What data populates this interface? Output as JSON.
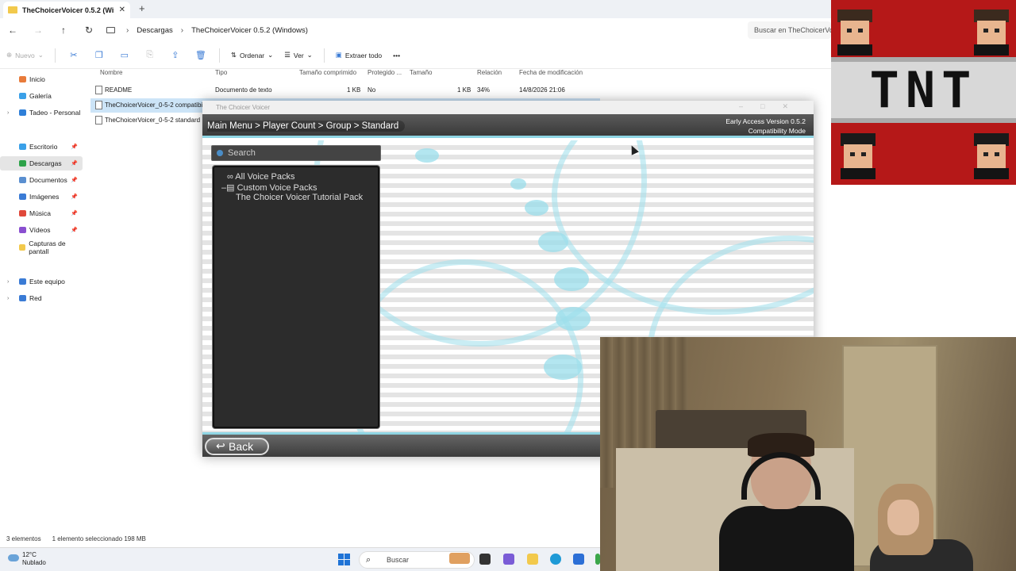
{
  "explorer": {
    "tab_title": "TheChoicerVoicer 0.5.2 (Wind",
    "tab_close": "✕",
    "new_tab": "+",
    "path": [
      "Descargas",
      "TheChoicerVoicer 0.5.2 (Windows)"
    ],
    "search_placeholder": "Buscar en TheChoicerVo",
    "toolbar": {
      "new": "Nuevo",
      "sort": "Ordenar",
      "view": "Ver",
      "extract": "Extraer todo",
      "more": "•••"
    },
    "sidebar": {
      "items": [
        {
          "label": "Inicio",
          "color": "#e87b3a"
        },
        {
          "label": "Galería",
          "color": "#3aa0e8"
        },
        {
          "label": "Tadeo - Personal",
          "color": "#2f7fd8"
        },
        {
          "label": "Escritorio",
          "color": "#3aa0e8"
        },
        {
          "label": "Descargas",
          "color": "#2ea34a"
        },
        {
          "label": "Documentos",
          "color": "#5a8fd0"
        },
        {
          "label": "Imágenes",
          "color": "#3a7bd5"
        },
        {
          "label": "Música",
          "color": "#e0483a"
        },
        {
          "label": "Vídeos",
          "color": "#8a4fd0"
        },
        {
          "label": "Capturas de pantall",
          "color": "#f2c94c"
        },
        {
          "label": "Este equipo",
          "color": "#3a7bd5"
        },
        {
          "label": "Red",
          "color": "#3a7bd5"
        }
      ]
    },
    "columns": [
      "Nombre",
      "Tipo",
      "Tamaño comprimido",
      "Protegido ...",
      "Tamaño",
      "Relación",
      "Fecha de modificación"
    ],
    "files": [
      {
        "name": "README",
        "type": "Documento de texto",
        "compressed": "1 KB",
        "protected": "No",
        "size": "1 KB",
        "ratio": "34%",
        "modified": "14/8/2026 21:06"
      },
      {
        "name": "TheChoicerVoicer_0-5-2 compatibility",
        "type": "",
        "compressed": "",
        "protected": "",
        "size": "",
        "ratio": "",
        "modified": ""
      },
      {
        "name": "TheChoicerVoicer_0-5-2 standard",
        "type": "",
        "compressed": "",
        "protected": "",
        "size": "",
        "ratio": "",
        "modified": ""
      }
    ],
    "status": {
      "count": "3 elementos",
      "selection": "1 elemento seleccionado  198 MB"
    }
  },
  "game": {
    "window_title": "The Choicer Voicer",
    "window_controls": "–□✕",
    "breadcrumb": "Main Menu > Player Count > Group > Standard",
    "version_line1": "Early Access Version 0.5.2",
    "version_line2": "Compatibility Mode",
    "search_placeholder": "Search",
    "packs": [
      {
        "icon": "∞",
        "label": "All Voice Packs",
        "indent": 0
      },
      {
        "icon": "–▤",
        "label": "Custom Voice Packs",
        "indent": 0
      },
      {
        "icon": "",
        "label": "The Choicer Voicer Tutorial Pack",
        "indent": 1
      }
    ],
    "back_label": "Back",
    "back_arrow": "↩",
    "accent": "#8fd5e3"
  },
  "overlay": {
    "tnt_text": "TNT"
  },
  "taskbar": {
    "temperature": "12°C",
    "weather": "Nublado",
    "search_placeholder": "Buscar"
  }
}
